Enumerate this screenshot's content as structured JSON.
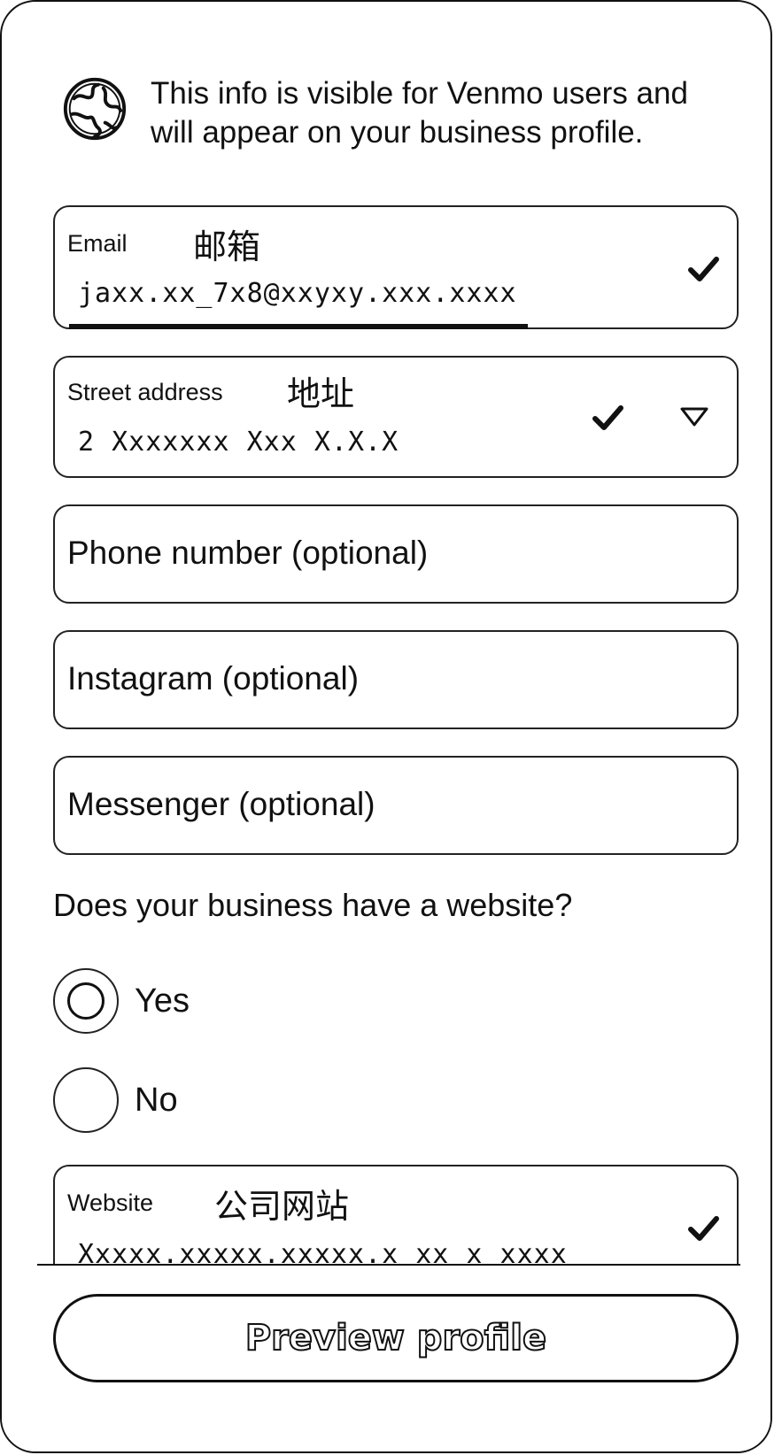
{
  "info": {
    "icon": "globe-icon",
    "text_line1": "This info is visible for Venmo users and",
    "text_line2": "will appear on your business profile."
  },
  "email": {
    "label": "Email",
    "annotation": "邮箱",
    "value": "jaxx.xx_7x8@xxyxy.xxx.xxxx",
    "icon": "check-icon"
  },
  "street": {
    "label": "Street address",
    "annotation": "地址",
    "value": "2 Xxxxxxx Xxx X.X.X",
    "icons": [
      "check-icon",
      "triangle-down-icon"
    ]
  },
  "phone": {
    "placeholder": "Phone number (optional)"
  },
  "instagram": {
    "placeholder": "Instagram (optional)"
  },
  "messenger": {
    "placeholder": "Messenger (optional)"
  },
  "website_question": {
    "question": "Does your business have a website?",
    "options": [
      "Yes",
      "No"
    ],
    "selected": "Yes"
  },
  "website": {
    "label": "Website",
    "annotation": "公司网站",
    "value": "Xxxxx.xxxxx.xxxxx.x xx x xxxx",
    "icon": "check-icon"
  },
  "preview_button": {
    "label": "Preview profile"
  }
}
